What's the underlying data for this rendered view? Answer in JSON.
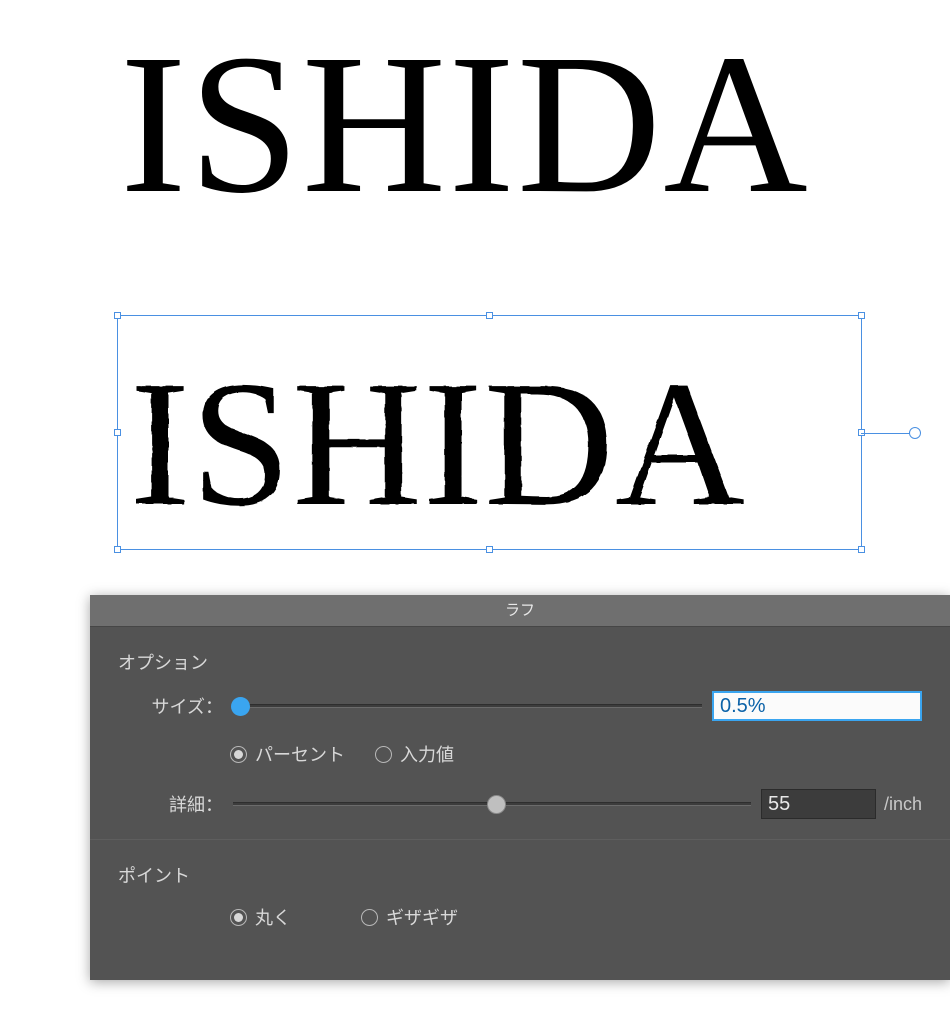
{
  "canvas": {
    "text_original": "ISHIDA",
    "text_roughened": "ISHIDA"
  },
  "panel": {
    "title": "ラフ",
    "section_options": "オプション",
    "size_label": "サイズ：",
    "size_value": "0.5%",
    "size_unit_percent": "パーセント",
    "size_unit_absolute": "入力値",
    "detail_label": "詳細：",
    "detail_value": "55",
    "detail_unit": "/inch",
    "section_points": "ポイント",
    "points_smooth": "丸く",
    "points_corner": "ギザギザ"
  }
}
